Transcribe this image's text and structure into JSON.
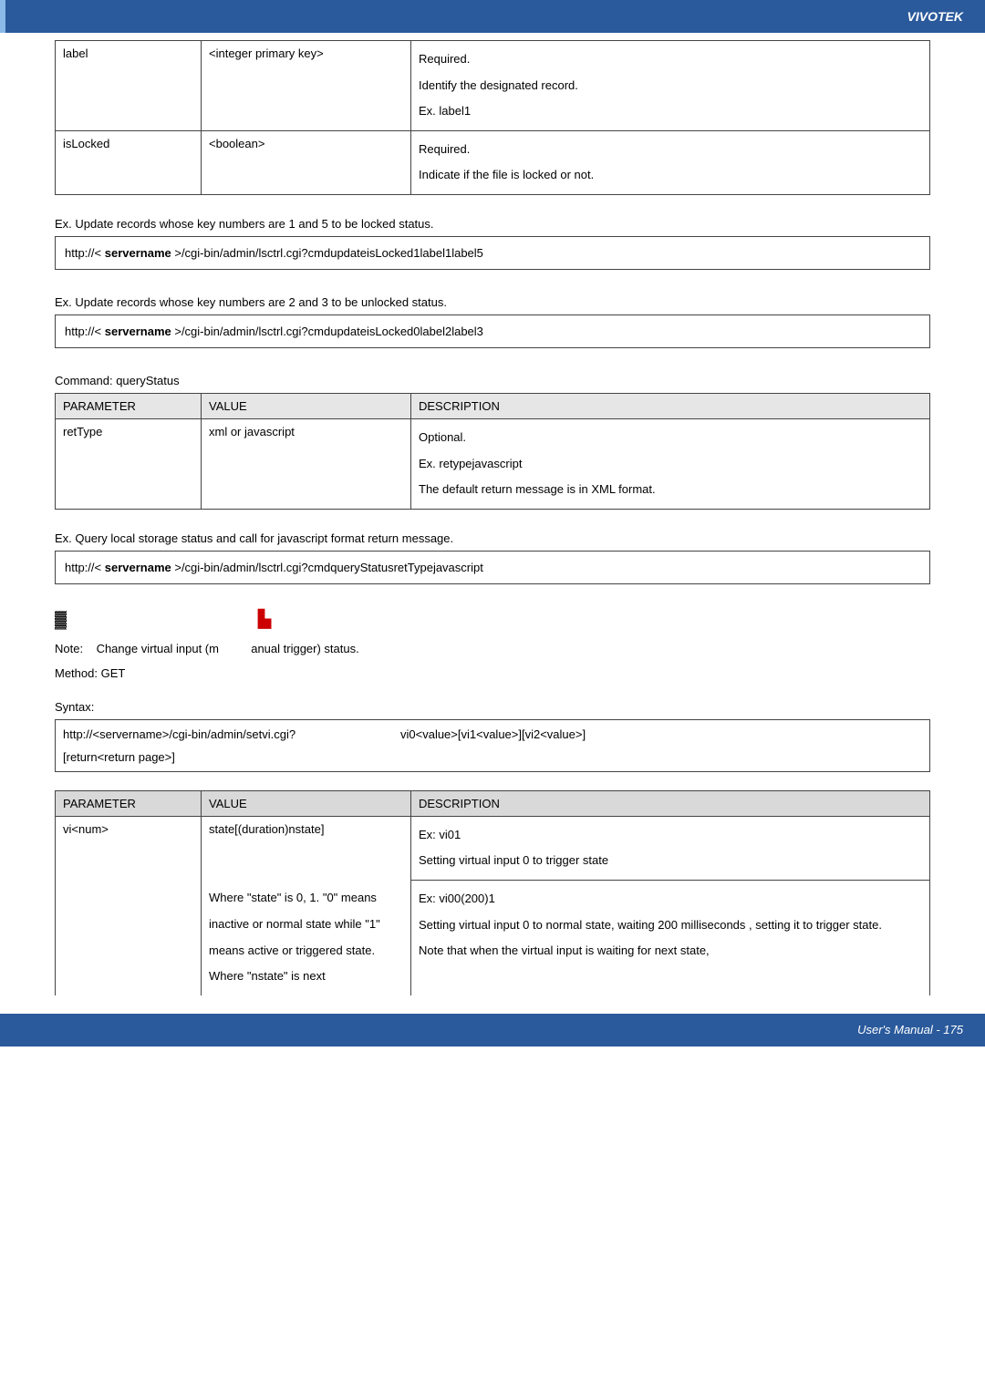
{
  "brand": "VIVOTEK",
  "footer_text": "User's Manual - 175",
  "table1": {
    "rows": [
      {
        "param": "label",
        "value": "<integer primary key>",
        "desc": "Required.\nIdentify the designated record.\nEx. label1"
      },
      {
        "param": "isLocked",
        "value": "<boolean>",
        "desc": "Required.\nIndicate if the file is locked or not."
      }
    ]
  },
  "ex1_text": "Ex. Update records whose key numbers are 1 and 5 to be locked status.",
  "ex1_prefix": "http://< ",
  "ex1_server": "servername",
  "ex1_suffix": " >/cgi-bin/admin/lsctrl.cgi?cmdupdateisLocked1label1label5",
  "ex2_text": "Ex. Update records whose key numbers are 2 and 3 to be unlocked status.",
  "ex2_prefix": "http://< ",
  "ex2_server": "servername",
  "ex2_suffix": " >/cgi-bin/admin/lsctrl.cgi?cmdupdateisLocked0label2label3",
  "command_label": "Command: queryStatus",
  "table2": {
    "headers": {
      "p": "PARAMETER",
      "v": "VALUE",
      "d": "DESCRIPTION"
    },
    "rows": [
      {
        "param": "retType",
        "value": "xml or javascript",
        "desc": "Optional.\nEx. retypejavascript\nThe default return message is in XML format."
      }
    ]
  },
  "ex3_text": "Ex. Query local storage status and call for javascript format return message.",
  "ex3_prefix": "http://< ",
  "ex3_server": "servername",
  "ex3_suffix": " >/cgi-bin/admin/lsctrl.cgi?cmdqueryStatusretTypejavascript",
  "note_prefix": "Note:",
  "note_body1": "Change virtual input (m",
  "note_body2": "anual trigger) status.",
  "method_line": "Method: GET",
  "syntax_label": "Syntax:",
  "syntax_left": "http://<servername>/cgi-bin/admin/setvi.cgi?",
  "syntax_right": "vi0<value>[vi1<value>][vi2<value>]",
  "syntax_line2": "[return<return page>]",
  "table3": {
    "headers": {
      "p": "PARAMETER",
      "v": "VALUE",
      "d": "DESCRIPTION"
    },
    "row": {
      "param": "vi<num>",
      "value_top": "state[(duration)nstate]",
      "value_rest": "Where \"state\" is 0, 1. \"0\" means inactive or normal state while \"1\" means active or triggered state. Where \"nstate\" is next",
      "desc_top": "Ex: vi01\nSetting virtual input 0 to trigger state",
      "desc_bottom": "Ex: vi00(200)1\nSetting virtual input 0 to normal state, waiting 200 milliseconds    , setting it to trigger state.\nNote that when the virtual input is waiting for next state,"
    }
  }
}
